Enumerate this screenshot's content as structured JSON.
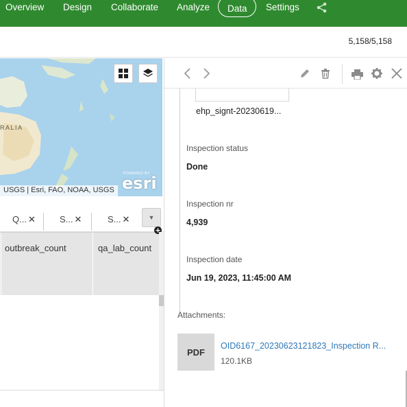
{
  "nav": {
    "tabs": [
      {
        "label": "Overview"
      },
      {
        "label": "Design"
      },
      {
        "label": "Collaborate"
      },
      {
        "label": "Analyze"
      },
      {
        "label": "Data",
        "active": true
      },
      {
        "label": "Settings"
      }
    ],
    "brand_color": "#2f8a2f"
  },
  "record_count": "5,158/5,158",
  "map": {
    "country_label": "RALIA",
    "attribution": "USGS | Esri, FAO, NOAA, USGS",
    "logo_small": "POWERED BY",
    "logo_text": "esri"
  },
  "table": {
    "filter_tabs": [
      {
        "label": "Q..."
      },
      {
        "label": "S..."
      },
      {
        "label": "S..."
      }
    ],
    "columns": [
      {
        "label": "outbreak_count"
      },
      {
        "label": "qa_lab_count"
      }
    ]
  },
  "panel": {
    "signature_file": "ehp_signt-20230619...",
    "fields": [
      {
        "label": "Inspection status",
        "value": "Done"
      },
      {
        "label": "Inspection nr",
        "value": "4,939"
      },
      {
        "label": "Inspection date",
        "value": "Jun 19, 2023, 11:45:00 AM"
      }
    ],
    "attachments_label": "Attachments:",
    "attachment": {
      "type": "PDF",
      "name": "OID6167_20230623121823_Inspection R...",
      "size": "120.1KB"
    },
    "link_color": "#2e78b7"
  }
}
